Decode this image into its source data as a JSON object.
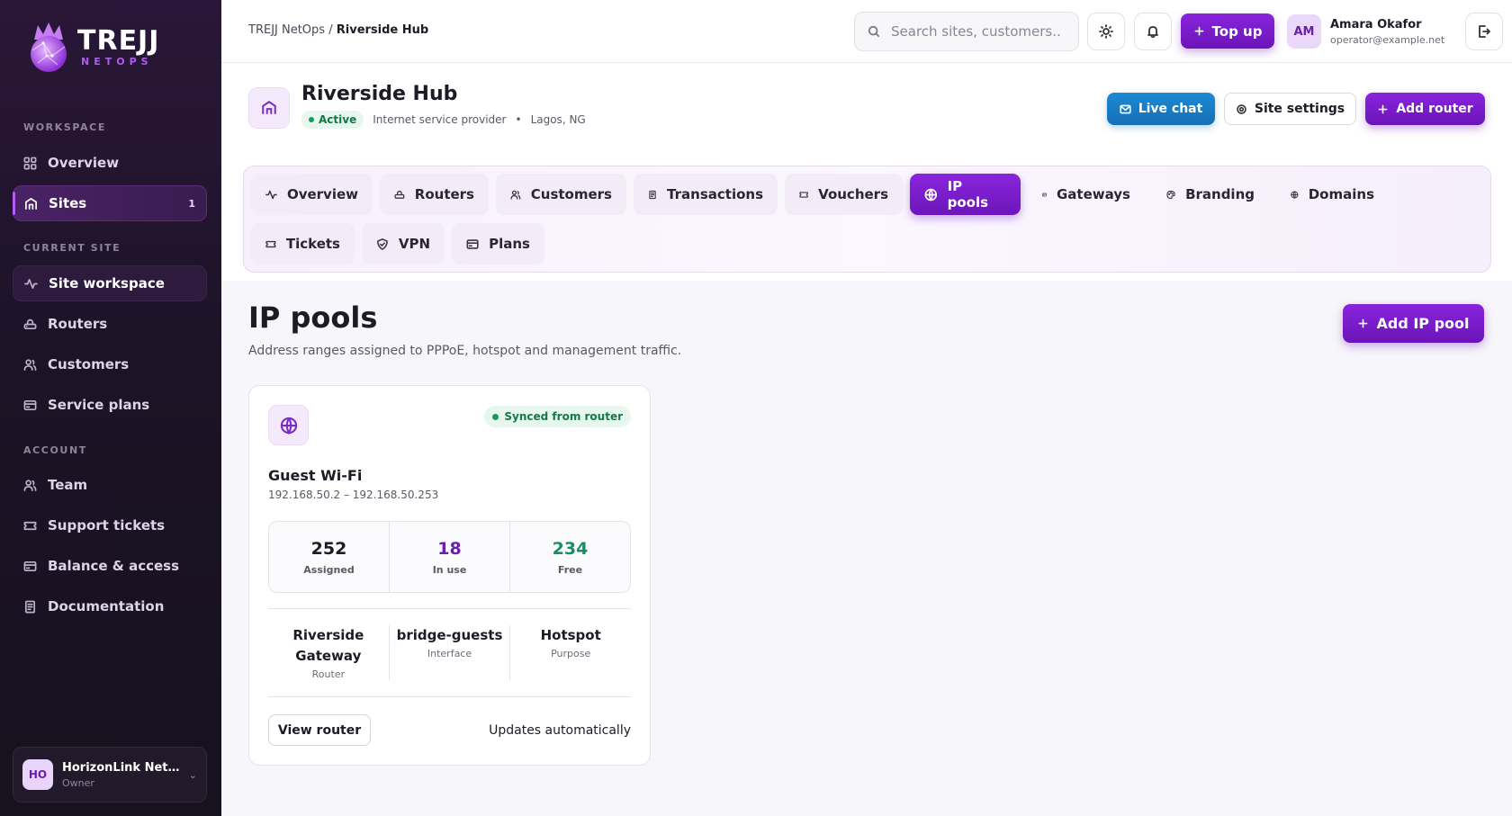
{
  "brand": {
    "title": "TREJJ",
    "subtitle": "NETOPS"
  },
  "sidebar": {
    "workspace_label": "WORKSPACE",
    "workspace_items": [
      {
        "label": "Overview",
        "icon": "grid-icon"
      },
      {
        "label": "Sites",
        "icon": "building-icon",
        "badge": "1"
      }
    ],
    "current_site_label": "CURRENT SITE",
    "current_site_items": [
      {
        "label": "Site workspace",
        "icon": "activity-icon"
      },
      {
        "label": "Routers",
        "icon": "router-icon"
      },
      {
        "label": "Customers",
        "icon": "users-icon"
      },
      {
        "label": "Service plans",
        "icon": "card-icon"
      }
    ],
    "account_label": "ACCOUNT",
    "account_items": [
      {
        "label": "Team",
        "icon": "users-icon"
      },
      {
        "label": "Support tickets",
        "icon": "ticket-icon"
      },
      {
        "label": "Balance & access",
        "icon": "card-icon"
      },
      {
        "label": "Documentation",
        "icon": "document-icon"
      }
    ],
    "org": {
      "initials": "HO",
      "name": "HorizonLink Net...",
      "role": "Owner"
    }
  },
  "header": {
    "breadcrumb_root": "TREJJ NetOps",
    "breadcrumb_sep": "/",
    "breadcrumb_current": "Riverside Hub",
    "search_placeholder": "Search sites, customers...",
    "top_up_label": "Top up",
    "user": {
      "initials": "AM",
      "name": "Amara Okafor",
      "email": "operator@example.net"
    }
  },
  "site": {
    "name": "Riverside Hub",
    "status": "Active",
    "type": "Internet service provider",
    "bullet": "•",
    "location": "Lagos, NG",
    "live_chat_label": "Live chat",
    "settings_label": "Site settings",
    "add_router_label": "Add router"
  },
  "tabs": [
    {
      "label": "Overview",
      "icon": "activity-icon"
    },
    {
      "label": "Routers",
      "icon": "router-icon"
    },
    {
      "label": "Customers",
      "icon": "users-icon"
    },
    {
      "label": "Transactions",
      "icon": "receipt-icon"
    },
    {
      "label": "Vouchers",
      "icon": "ticket-icon"
    },
    {
      "label": "IP pools",
      "icon": "globe-icon",
      "active": true
    },
    {
      "label": "Gateways",
      "icon": "card-icon"
    },
    {
      "label": "Branding",
      "icon": "palette-icon"
    },
    {
      "label": "Domains",
      "icon": "globe-icon"
    },
    {
      "label": "Tickets",
      "icon": "ticket-icon"
    },
    {
      "label": "VPN",
      "icon": "shield-icon"
    },
    {
      "label": "Plans",
      "icon": "card-icon"
    }
  ],
  "main": {
    "title": "IP pools",
    "subtitle": "Address ranges assigned to PPPoE, hotspot and management traffic.",
    "add_pool_label": "Add IP pool"
  },
  "pool": {
    "sync_status": "Synced from router",
    "name": "Guest Wi-Fi",
    "range": "192.168.50.2 – 192.168.50.253",
    "stats": [
      {
        "value": "252",
        "label": "Assigned",
        "color": "#1d1b26"
      },
      {
        "value": "18",
        "label": "In use",
        "color": "#6a1fb0"
      },
      {
        "value": "234",
        "label": "Free",
        "color": "#159062"
      }
    ],
    "router": "Riverside Gateway",
    "router_label": "Router",
    "interface": "bridge-guests",
    "interface_label": "Interface",
    "purpose": "Hotspot",
    "purpose_label": "Purpose",
    "view_router_label": "View router",
    "updates_text": "Updates automatically"
  },
  "colors": {
    "accent": "#7a1fcc",
    "sidebar_bg": "#1c1326",
    "success": "#137a45",
    "chat_blue": "#1a80c8"
  }
}
